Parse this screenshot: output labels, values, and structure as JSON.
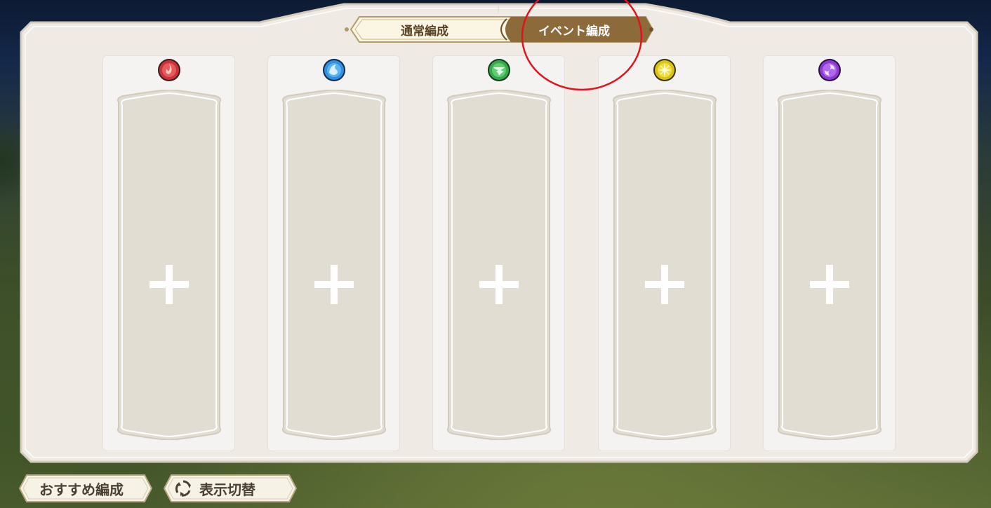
{
  "tabs": {
    "normal_label": "通常編成",
    "event_label": "イベント編成",
    "active": "event"
  },
  "slots": [
    {
      "element": "fire-icon",
      "color": "#c8323a"
    },
    {
      "element": "water-icon",
      "color": "#2f8fe0"
    },
    {
      "element": "wind-icon",
      "color": "#36a94a"
    },
    {
      "element": "light-icon",
      "color": "#d9c21a"
    },
    {
      "element": "dark-icon",
      "color": "#8a3ad0"
    }
  ],
  "buttons": {
    "recommend_label": "おすすめ編成",
    "toggle_view_label": "表示切替"
  },
  "colors": {
    "panel": "#efebe4",
    "panel_border": "#d9d0c0",
    "tab_active": "#8c6a3a",
    "tab_inactive": "#fbf5e3",
    "slot_fill": "#e2ddd3",
    "annotation": "#e0141e"
  }
}
